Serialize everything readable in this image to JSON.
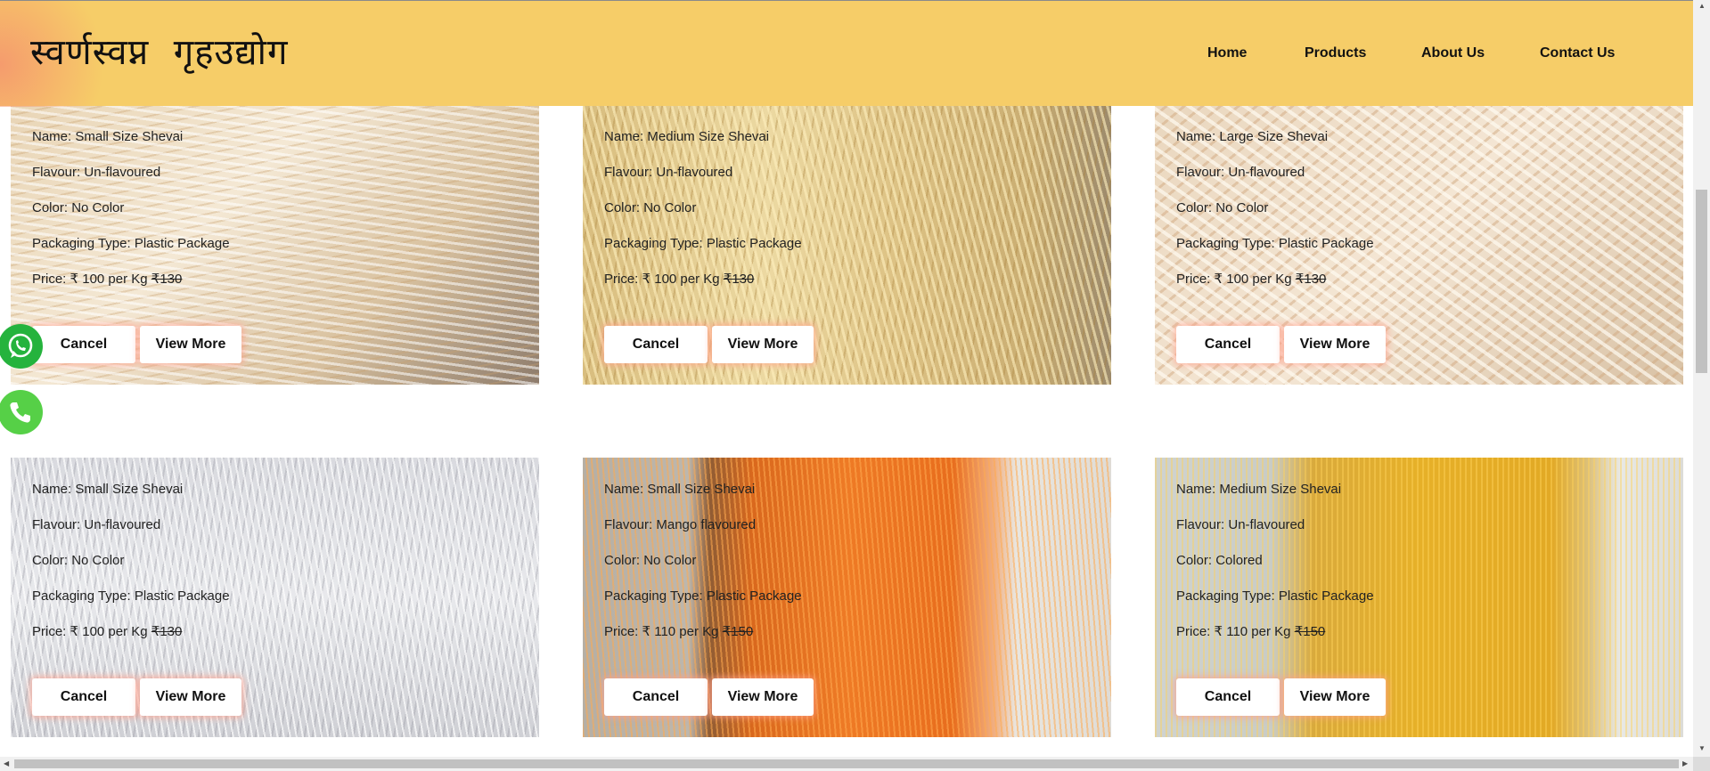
{
  "header": {
    "brand": "स्वर्णस्वप्न  गृहउद्योग",
    "nav": [
      "Home",
      "Products",
      "About Us",
      "Contact Us"
    ],
    "color": "#f6cd68"
  },
  "labels": {
    "name": "Name: ",
    "flavour": "Flavour: ",
    "color": "Color: ",
    "packaging": "Packaging Type: ",
    "price": "Price: ",
    "cancel": "Cancel",
    "view_more": "View More"
  },
  "products": [
    {
      "name": "Small Size Shevai",
      "flavour": "Un-flavoured",
      "color": "No Color",
      "packaging": "Plastic Package",
      "price": "₹ 100 per Kg",
      "old_price": "₹130",
      "image": "pale-vermicelli"
    },
    {
      "name": "Medium Size Shevai",
      "flavour": "Un-flavoured",
      "color": "No Color",
      "packaging": "Plastic Package",
      "price": "₹ 100 per Kg",
      "old_price": "₹130",
      "image": "yellow-vermicelli"
    },
    {
      "name": "Large Size Shevai",
      "flavour": "Un-flavoured",
      "color": "No Color",
      "packaging": "Plastic Package",
      "price": "₹ 100 per Kg",
      "old_price": "₹130",
      "image": "short-vermicelli"
    },
    {
      "name": "Small Size Shevai",
      "flavour": "Un-flavoured",
      "color": "No Color",
      "packaging": "Plastic Package",
      "price": "₹ 100 per Kg",
      "old_price": "₹130",
      "image": "white-vermicelli"
    },
    {
      "name": "Small Size Shevai",
      "flavour": "Mango flavoured",
      "color": "No Color",
      "packaging": "Plastic Package",
      "price": "₹ 110 per Kg",
      "old_price": "₹150",
      "image": "orange-vermicelli"
    },
    {
      "name": "Medium Size Shevai",
      "flavour": "Un-flavoured",
      "color": "Colored",
      "packaging": "Plastic Package",
      "price": "₹ 110 per Kg",
      "old_price": "₹150",
      "image": "golden-vermicelli"
    }
  ],
  "floating": [
    "whatsapp-icon",
    "phone-icon"
  ]
}
